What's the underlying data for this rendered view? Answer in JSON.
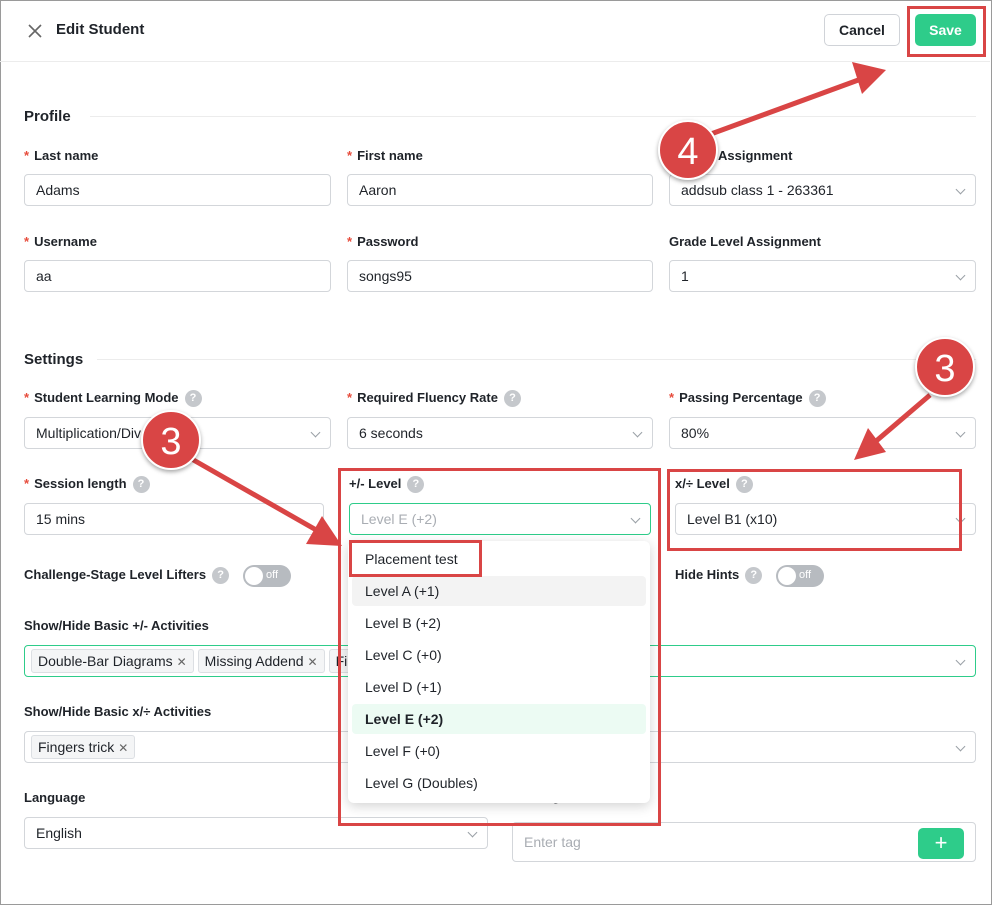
{
  "header": {
    "title": "Edit Student",
    "cancel_label": "Cancel",
    "save_label": "Save"
  },
  "profile": {
    "title": "Profile",
    "last_name": {
      "label": "Last name",
      "value": "Adams"
    },
    "first_name": {
      "label": "First name",
      "value": "Aaron"
    },
    "assignment": {
      "label": "Assignment",
      "value": "addsub class 1 - 263361"
    },
    "username": {
      "label": "Username",
      "value": "aa"
    },
    "password": {
      "label": "Password",
      "value": "songs95"
    },
    "grade_level": {
      "label": "Grade Level Assignment",
      "value": "1"
    }
  },
  "settings": {
    "title": "Settings",
    "learning_mode": {
      "label": "Student Learning Mode",
      "value": "Multiplication/Div"
    },
    "fluency_rate": {
      "label": "Required Fluency Rate",
      "value": "6 seconds"
    },
    "passing_pct": {
      "label": "Passing Percentage",
      "value": "80%"
    },
    "session_length": {
      "label": "Session length",
      "value": "15 mins"
    },
    "addsub_level": {
      "label": "+/- Level",
      "placeholder": "Level E (+2)"
    },
    "muldiv_level": {
      "label": "x/÷ Level",
      "value": "Level B1 (x10)"
    },
    "challenge_lifters": {
      "label": "Challenge-Stage Level Lifters",
      "state": "off"
    },
    "hide_hints": {
      "label": "Hide Hints",
      "state": "off"
    },
    "addsub_activities": {
      "label": "Show/Hide Basic +/- Activities",
      "tags": [
        "Double-Bar Diagrams",
        "Missing Addend",
        "Fin"
      ]
    },
    "muldiv_activities": {
      "label": "Show/Hide Basic x/÷ Activities",
      "tags": [
        "Fingers trick"
      ]
    },
    "language": {
      "label": "Language",
      "value": "English"
    },
    "tag": {
      "label_visible": "g",
      "placeholder": "Enter tag",
      "add_symbol": "+"
    }
  },
  "dropdown": {
    "items": [
      "Placement test",
      "Level A (+1)",
      "Level B (+2)",
      "Level C (+0)",
      "Level D (+1)",
      "Level E (+2)",
      "Level F (+0)",
      "Level G (Doubles)"
    ],
    "hovered": "Level A (+1)",
    "selected": "Level E (+2)"
  },
  "annotations": {
    "callout_3": "3",
    "callout_4": "4",
    "color": "#d94545"
  },
  "icons": {
    "close": "close-icon",
    "help": "help-icon",
    "chevron": "chevron-down-icon",
    "tag_remove": "close-icon",
    "add": "plus-icon"
  },
  "colors": {
    "accent": "#2ecc8a",
    "required": "#e74c3c",
    "annotation": "#d94545"
  }
}
